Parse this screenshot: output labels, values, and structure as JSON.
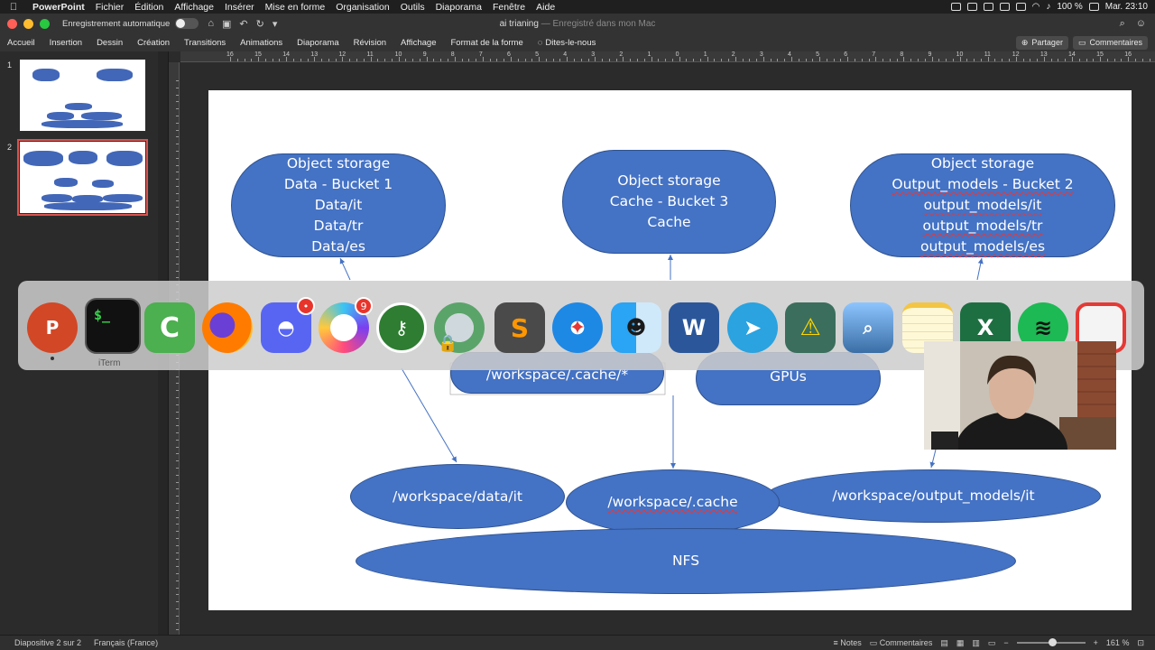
{
  "menubar": {
    "app_name": "PowerPoint",
    "items": [
      "Fichier",
      "Édition",
      "Affichage",
      "Insérer",
      "Mise en forme",
      "Organisation",
      "Outils",
      "Diaporama",
      "Fenêtre",
      "Aide"
    ],
    "battery": "100 %",
    "clock": "Mar. 23:10"
  },
  "titlebar": {
    "autosave_label": "Enregistrement automatique",
    "doc_name": "ai trianing",
    "doc_status": " — Enregistré dans mon Mac"
  },
  "ribbon": {
    "tabs": [
      "Accueil",
      "Insertion",
      "Dessin",
      "Création",
      "Transitions",
      "Animations",
      "Diaporama",
      "Révision",
      "Affichage",
      "Format de la forme"
    ],
    "tell_me": "Dites-le-nous",
    "share": "Partager",
    "comments": "Commentaires"
  },
  "thumbnails": [
    "1",
    "2"
  ],
  "ruler_labels": [
    "16",
    "15",
    "14",
    "13",
    "12",
    "11",
    "10",
    "9",
    "8",
    "7",
    "6",
    "5",
    "4",
    "3",
    "2",
    "1",
    "0",
    "1",
    "2",
    "3",
    "4",
    "5",
    "6",
    "7",
    "8",
    "9",
    "10",
    "11",
    "12",
    "13",
    "14",
    "15",
    "16"
  ],
  "slide": {
    "bucket1": [
      "Object storage",
      "Data - Bucket 1",
      "Data/it",
      "Data/tr",
      "Data/es"
    ],
    "bucket3": [
      "Object storage",
      "Cache - Bucket 3",
      "Cache"
    ],
    "bucket2": [
      "Object storage",
      "Output_models - Bucket 2",
      "output_models/it",
      "output_models/tr",
      "output_models/es"
    ],
    "cache_star": "/workspace/.cache/*",
    "gpus": "GPUs",
    "data_it": "/workspace/data/it",
    "cache": "/workspace/.cache",
    "output_it": "/workspace/output_models/it",
    "nfs": "NFS"
  },
  "dock": {
    "iterm_label": "iTerm",
    "discord_badge": "•",
    "cleanmaster_badge": "9"
  },
  "statusbar": {
    "slide_info": "Diapositive 2 sur 2",
    "language": "Français (France)",
    "notes": "Notes",
    "comments": "Commentaires",
    "zoom": "161 %"
  }
}
